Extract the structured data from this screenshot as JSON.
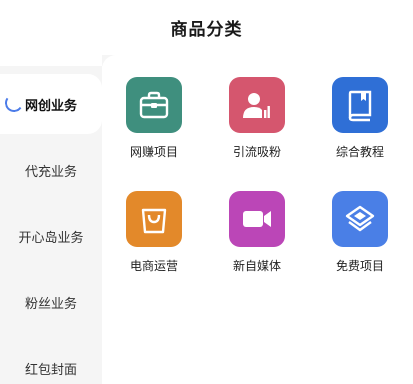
{
  "header": {
    "title": "商品分类"
  },
  "sidebar": {
    "items": [
      {
        "label": "网创业务",
        "active": true
      },
      {
        "label": "代充业务",
        "active": false
      },
      {
        "label": "开心岛业务",
        "active": false
      },
      {
        "label": "粉丝业务",
        "active": false
      },
      {
        "label": "红包封面",
        "active": false
      }
    ]
  },
  "grid": {
    "items": [
      {
        "label": "网赚项目",
        "icon": "briefcase-icon",
        "color": "#3f8f7e"
      },
      {
        "label": "引流吸粉",
        "icon": "user-chart-icon",
        "color": "#d5566e"
      },
      {
        "label": "综合教程",
        "icon": "book-icon",
        "color": "#2f6fd6"
      },
      {
        "label": "电商运营",
        "icon": "shopping-bag-icon",
        "color": "#e3892a"
      },
      {
        "label": "新自媒体",
        "icon": "video-camera-icon",
        "color": "#bb46b7"
      },
      {
        "label": "免费项目",
        "icon": "layers-icon",
        "color": "#4a7fe6"
      }
    ]
  }
}
